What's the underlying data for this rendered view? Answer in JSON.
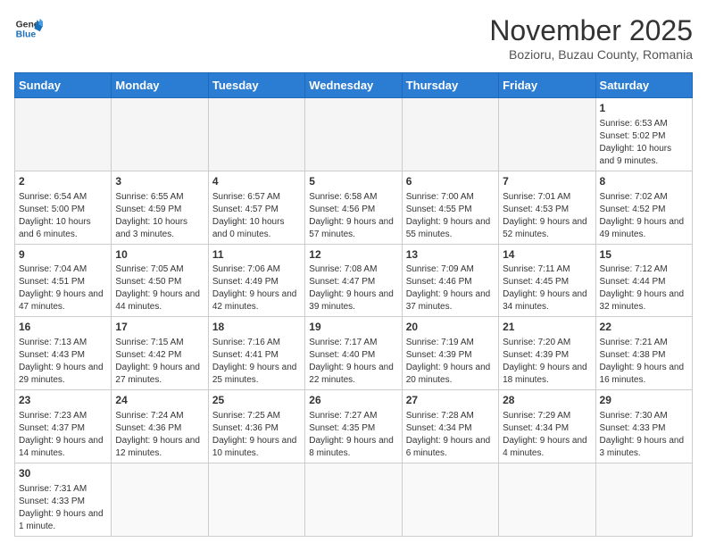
{
  "header": {
    "logo_general": "General",
    "logo_blue": "Blue",
    "month": "November 2025",
    "location": "Bozioru, Buzau County, Romania"
  },
  "weekdays": [
    "Sunday",
    "Monday",
    "Tuesday",
    "Wednesday",
    "Thursday",
    "Friday",
    "Saturday"
  ],
  "weeks": [
    [
      {
        "day": "",
        "info": ""
      },
      {
        "day": "",
        "info": ""
      },
      {
        "day": "",
        "info": ""
      },
      {
        "day": "",
        "info": ""
      },
      {
        "day": "",
        "info": ""
      },
      {
        "day": "",
        "info": ""
      },
      {
        "day": "1",
        "info": "Sunrise: 6:53 AM\nSunset: 5:02 PM\nDaylight: 10 hours and 9 minutes."
      }
    ],
    [
      {
        "day": "2",
        "info": "Sunrise: 6:54 AM\nSunset: 5:00 PM\nDaylight: 10 hours and 6 minutes."
      },
      {
        "day": "3",
        "info": "Sunrise: 6:55 AM\nSunset: 4:59 PM\nDaylight: 10 hours and 3 minutes."
      },
      {
        "day": "4",
        "info": "Sunrise: 6:57 AM\nSunset: 4:57 PM\nDaylight: 10 hours and 0 minutes."
      },
      {
        "day": "5",
        "info": "Sunrise: 6:58 AM\nSunset: 4:56 PM\nDaylight: 9 hours and 57 minutes."
      },
      {
        "day": "6",
        "info": "Sunrise: 7:00 AM\nSunset: 4:55 PM\nDaylight: 9 hours and 55 minutes."
      },
      {
        "day": "7",
        "info": "Sunrise: 7:01 AM\nSunset: 4:53 PM\nDaylight: 9 hours and 52 minutes."
      },
      {
        "day": "8",
        "info": "Sunrise: 7:02 AM\nSunset: 4:52 PM\nDaylight: 9 hours and 49 minutes."
      }
    ],
    [
      {
        "day": "9",
        "info": "Sunrise: 7:04 AM\nSunset: 4:51 PM\nDaylight: 9 hours and 47 minutes."
      },
      {
        "day": "10",
        "info": "Sunrise: 7:05 AM\nSunset: 4:50 PM\nDaylight: 9 hours and 44 minutes."
      },
      {
        "day": "11",
        "info": "Sunrise: 7:06 AM\nSunset: 4:49 PM\nDaylight: 9 hours and 42 minutes."
      },
      {
        "day": "12",
        "info": "Sunrise: 7:08 AM\nSunset: 4:47 PM\nDaylight: 9 hours and 39 minutes."
      },
      {
        "day": "13",
        "info": "Sunrise: 7:09 AM\nSunset: 4:46 PM\nDaylight: 9 hours and 37 minutes."
      },
      {
        "day": "14",
        "info": "Sunrise: 7:11 AM\nSunset: 4:45 PM\nDaylight: 9 hours and 34 minutes."
      },
      {
        "day": "15",
        "info": "Sunrise: 7:12 AM\nSunset: 4:44 PM\nDaylight: 9 hours and 32 minutes."
      }
    ],
    [
      {
        "day": "16",
        "info": "Sunrise: 7:13 AM\nSunset: 4:43 PM\nDaylight: 9 hours and 29 minutes."
      },
      {
        "day": "17",
        "info": "Sunrise: 7:15 AM\nSunset: 4:42 PM\nDaylight: 9 hours and 27 minutes."
      },
      {
        "day": "18",
        "info": "Sunrise: 7:16 AM\nSunset: 4:41 PM\nDaylight: 9 hours and 25 minutes."
      },
      {
        "day": "19",
        "info": "Sunrise: 7:17 AM\nSunset: 4:40 PM\nDaylight: 9 hours and 22 minutes."
      },
      {
        "day": "20",
        "info": "Sunrise: 7:19 AM\nSunset: 4:39 PM\nDaylight: 9 hours and 20 minutes."
      },
      {
        "day": "21",
        "info": "Sunrise: 7:20 AM\nSunset: 4:39 PM\nDaylight: 9 hours and 18 minutes."
      },
      {
        "day": "22",
        "info": "Sunrise: 7:21 AM\nSunset: 4:38 PM\nDaylight: 9 hours and 16 minutes."
      }
    ],
    [
      {
        "day": "23",
        "info": "Sunrise: 7:23 AM\nSunset: 4:37 PM\nDaylight: 9 hours and 14 minutes."
      },
      {
        "day": "24",
        "info": "Sunrise: 7:24 AM\nSunset: 4:36 PM\nDaylight: 9 hours and 12 minutes."
      },
      {
        "day": "25",
        "info": "Sunrise: 7:25 AM\nSunset: 4:36 PM\nDaylight: 9 hours and 10 minutes."
      },
      {
        "day": "26",
        "info": "Sunrise: 7:27 AM\nSunset: 4:35 PM\nDaylight: 9 hours and 8 minutes."
      },
      {
        "day": "27",
        "info": "Sunrise: 7:28 AM\nSunset: 4:34 PM\nDaylight: 9 hours and 6 minutes."
      },
      {
        "day": "28",
        "info": "Sunrise: 7:29 AM\nSunset: 4:34 PM\nDaylight: 9 hours and 4 minutes."
      },
      {
        "day": "29",
        "info": "Sunrise: 7:30 AM\nSunset: 4:33 PM\nDaylight: 9 hours and 3 minutes."
      }
    ],
    [
      {
        "day": "30",
        "info": "Sunrise: 7:31 AM\nSunset: 4:33 PM\nDaylight: 9 hours and 1 minute."
      },
      {
        "day": "",
        "info": ""
      },
      {
        "day": "",
        "info": ""
      },
      {
        "day": "",
        "info": ""
      },
      {
        "day": "",
        "info": ""
      },
      {
        "day": "",
        "info": ""
      },
      {
        "day": "",
        "info": ""
      }
    ]
  ]
}
